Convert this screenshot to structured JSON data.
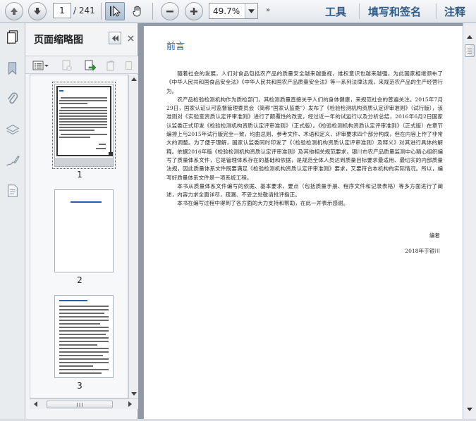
{
  "toolbar": {
    "current_page": "1",
    "total_pages": "/ 241",
    "zoom": "49.7%",
    "more": "»",
    "tools_label": "工具",
    "sign_label": "填写和签名",
    "comment_label": "注释"
  },
  "sidebar": {
    "title": "页面缩略图",
    "thumbnails": [
      {
        "label": "1"
      },
      {
        "label": "2"
      },
      {
        "label": "3"
      }
    ]
  },
  "document": {
    "heading": "前言",
    "paragraphs": [
      "随着社会的发展，人们对食品包括农产品的质量安全越来越重视，维权意识也越来越强，为此国家相继颁布了《中华人民共和国食品安全法》《中华人民共和国农产品质量安全法》等一系列法律法规，来规范农产品的生产经营行为。",
      "农产品检验检测机构作为质检部门，其检测质量直接关乎人们的身体健康，来规范社会的普遍关注。2015年7月29日，国家认证认可监督管理委员会（简称“国家认监委”）发布了《检验检测机构资质认定评审准则》（试行版），该准则对《实验室资质认定评审准则》进行了颠覆性的改变，经过近一年的试运行以及分析总结，2016年6月2日国家认监委正式印发《检验检测机构资质认定评审准则》（正式版）。《检验检测机构资质认定评审准则》（正式版）在章节编排上与2015年试行版完全一致，均由总则、参考文件、术语和定义、评审要求四个部分构成，但在内容上作了非常大的调整。为了便于理解，国家认监委同时印发了《〈检验检测机构资质认定评审准则〉及释义》对其进行具体的解释。依据2016年版《检验检测机构资质认定评审准则》及其他相关规范要求，银川市农产品质量监测中心精心组织编写了质量体系文件，它是管理体系存在的基础和依据，是规范全体人员达到质量目标要求最适用、最切实的内部质量法规，因此质量体系文件既要满足《检验检测机构资质认定评审准则》要求，又要符合本机构的实际情况。所以，编写好质量体系文件是一项系统工程。",
      "本书从质量体系文件编写的依据、基本要求、要点（包括质量手册、程序文件和记录表格）等多方面进行了阐述，内容力求全面详尽，疏漏、不妥之处敬请批评指正。",
      "本书在编写过程中得到了各方面的大力支持和帮助，在此一并表示感谢。"
    ],
    "signature": "编者",
    "date": "2018年于银川"
  },
  "colors": {
    "accent": "#2f5b86",
    "heading": "#2a5fa8"
  }
}
